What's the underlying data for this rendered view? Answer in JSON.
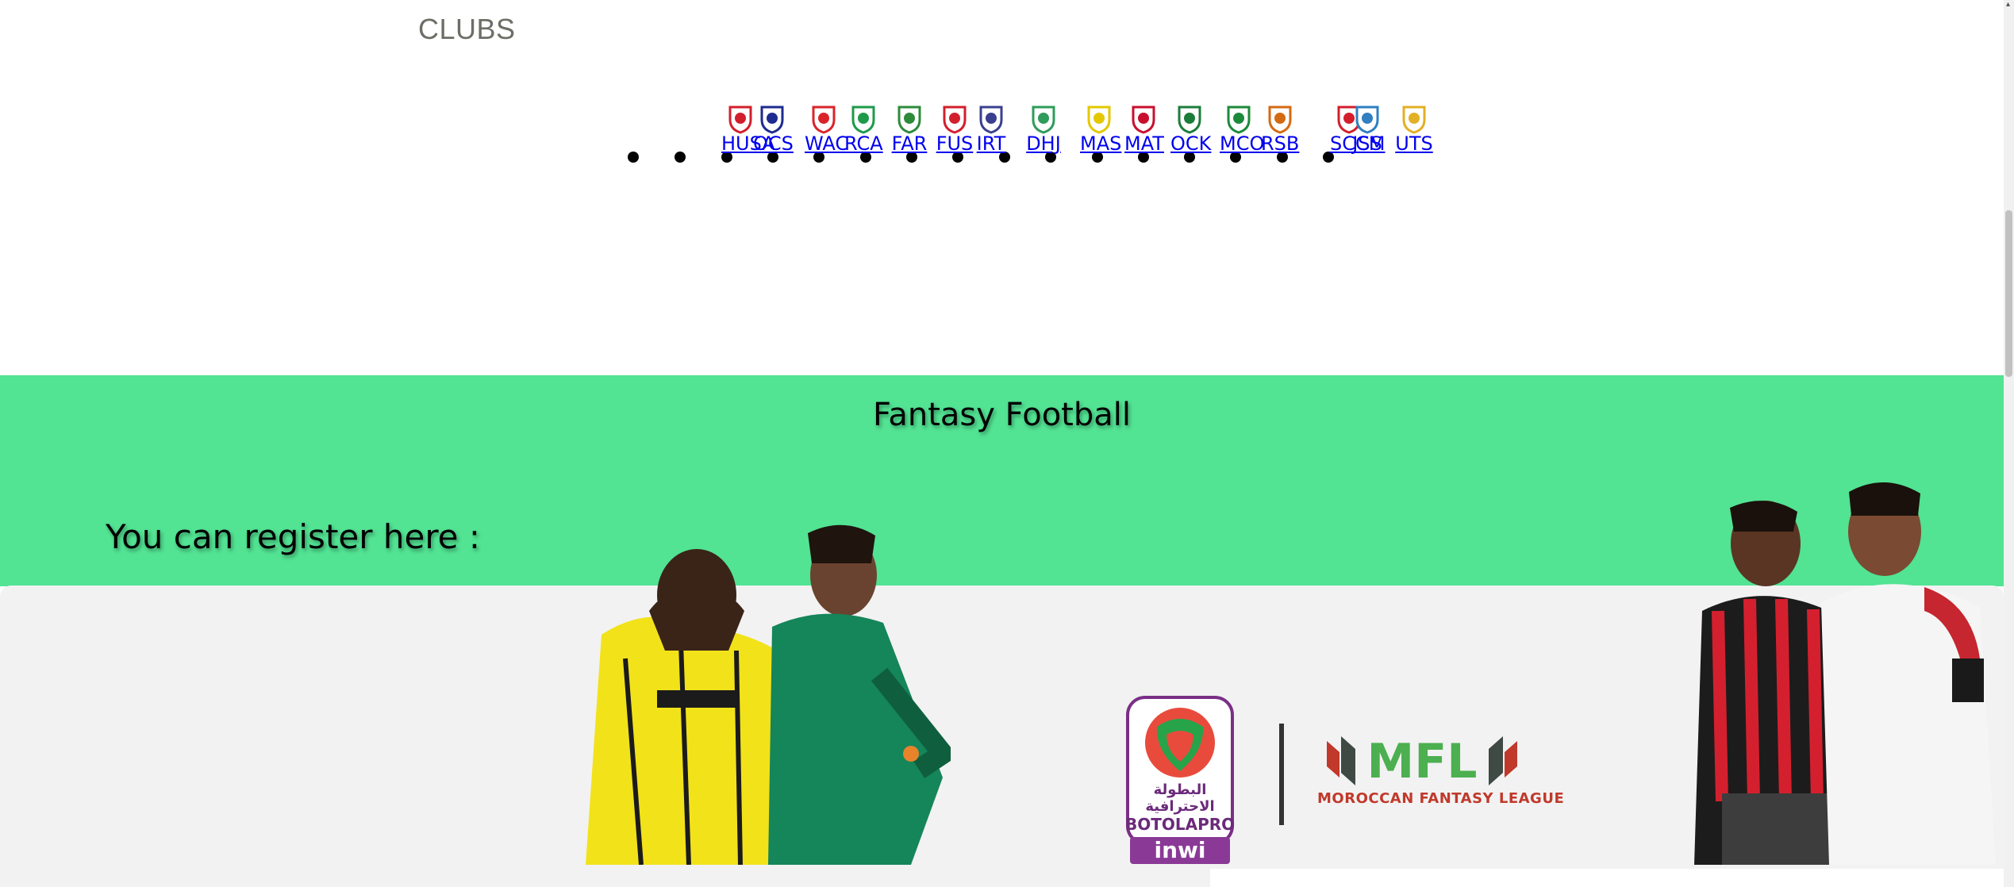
{
  "clubs_section": {
    "title": "CLUBS",
    "clubs": [
      {
        "abbr": "HUSA",
        "icon": "husa-crest-icon",
        "color": "#d31f2c"
      },
      {
        "abbr": "OCS",
        "icon": "ocs-crest-icon",
        "color": "#1e2b8f"
      },
      {
        "abbr": "WAC",
        "icon": "wac-crest-icon",
        "color": "#d9252a"
      },
      {
        "abbr": "RCA",
        "icon": "rca-crest-icon",
        "color": "#1f9a4a"
      },
      {
        "abbr": "FAR",
        "icon": "far-crest-icon",
        "color": "#2e8b3a"
      },
      {
        "abbr": "FUS",
        "icon": "fus-crest-icon",
        "color": "#d31f2c"
      },
      {
        "abbr": "IRT",
        "icon": "irt-crest-icon",
        "color": "#3a3f8f"
      },
      {
        "abbr": "DHJ",
        "icon": "dhj-crest-icon",
        "color": "#2e9c5a"
      },
      {
        "abbr": "MAS",
        "icon": "mas-crest-icon",
        "color": "#e3c800"
      },
      {
        "abbr": "MAT",
        "icon": "mat-crest-icon",
        "color": "#c8102e"
      },
      {
        "abbr": "OCK",
        "icon": "ock-crest-icon",
        "color": "#1c7d3b"
      },
      {
        "abbr": "MCO",
        "icon": "mco-crest-icon",
        "color": "#1c8a3a"
      },
      {
        "abbr": "RSB",
        "icon": "rsb-crest-icon",
        "color": "#d46a12"
      },
      {
        "abbr": "SCCM",
        "icon": "sccm-crest-icon",
        "color": "#d31f2c"
      },
      {
        "abbr": "JSS",
        "icon": "jss-crest-icon",
        "color": "#2f7fc1"
      },
      {
        "abbr": "UTS",
        "icon": "uts-crest-icon",
        "color": "#e2b024"
      }
    ]
  },
  "fantasy_section": {
    "title": "Fantasy Football",
    "register_text": "You can register here :",
    "band_color": "#52e393",
    "panel_color": "#f2f2f2"
  },
  "promo": {
    "botola_arabic": "البطولة الاحترافية",
    "botola_name": "BOTOLAPRO",
    "botola_sponsor": "inwi",
    "mfl_name": "MFL",
    "mfl_full": "MOROCCAN FANTASY LEAGUE",
    "mfl_color": "#4caf50",
    "mfl_sub_color": "#c0392b"
  }
}
